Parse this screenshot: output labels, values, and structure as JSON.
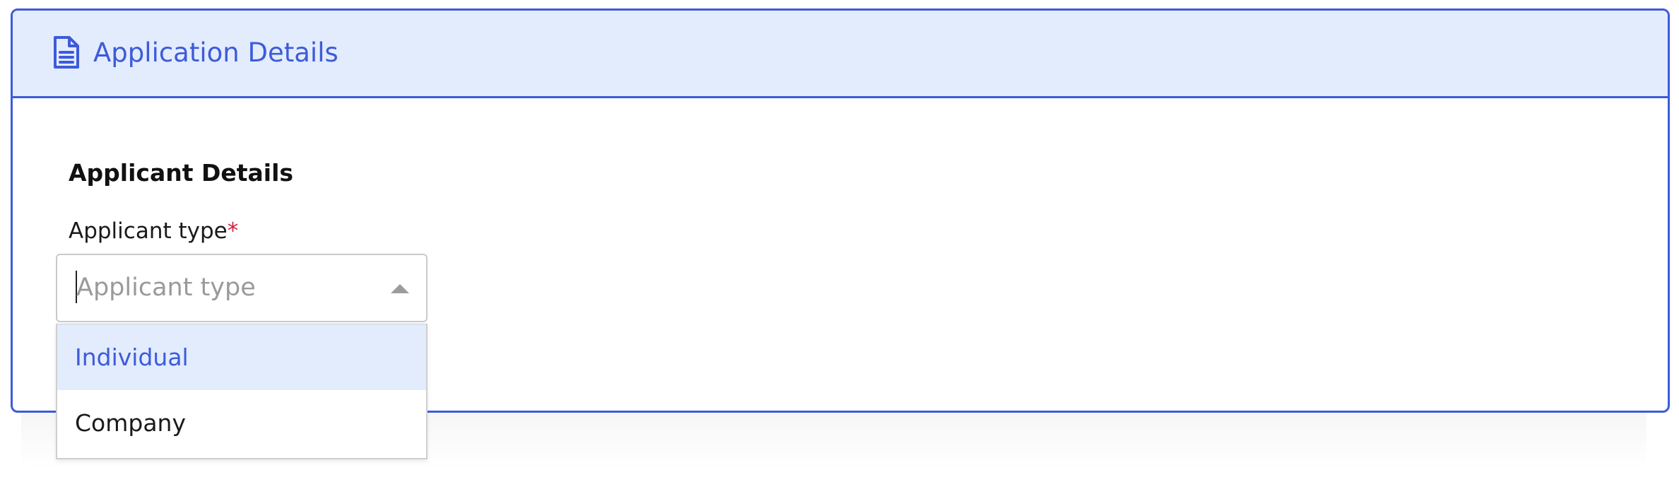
{
  "header": {
    "title": "Application Details",
    "icon": "document-icon",
    "accent_color": "#3d5bd9",
    "background_color": "#e3ecfd"
  },
  "applicant_section": {
    "title": "Applicant Details",
    "applicant_type": {
      "label": "Applicant type",
      "required_marker": "*",
      "placeholder": "Applicant type",
      "value": "",
      "options": [
        {
          "label": "Individual",
          "highlighted": true
        },
        {
          "label": "Company",
          "highlighted": false
        }
      ],
      "dropdown_open": true,
      "toggle_icon": "chevron-up-icon"
    }
  }
}
